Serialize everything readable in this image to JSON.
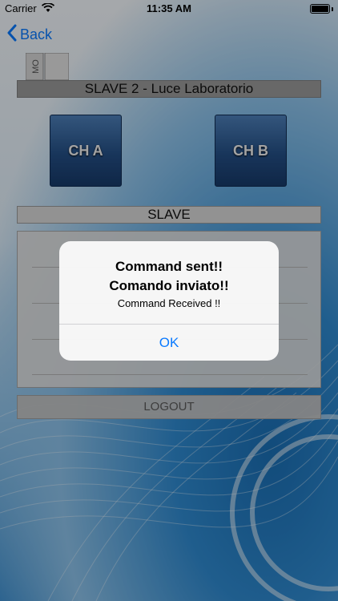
{
  "status_bar": {
    "carrier": "Carrier",
    "time": "11:35 AM",
    "battery_level": 1.0
  },
  "nav": {
    "back_label": "Back",
    "back_icon": "chevron-left-icon"
  },
  "logo": {
    "text": "MO"
  },
  "device": {
    "title": "SLAVE 2 - Luce Laboratorio",
    "channels": [
      "CH A",
      "CH B"
    ]
  },
  "slave_section": {
    "header": "SLAVE"
  },
  "logout_label": "LOGOUT",
  "alert": {
    "title_line1": "Command sent!!",
    "title_line2": "Comando inviato!!",
    "message": "Command Received !!",
    "ok_label": "OK"
  },
  "colors": {
    "accent": "#0a7aff",
    "channel_button": "#244f86"
  }
}
